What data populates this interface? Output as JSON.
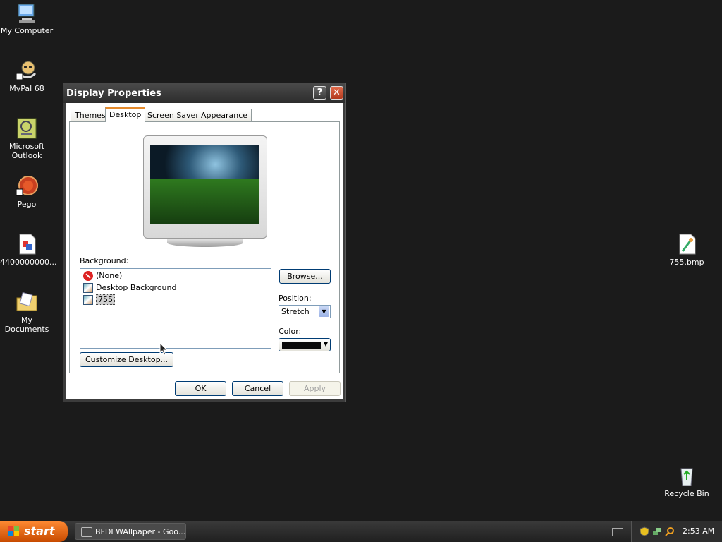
{
  "desktop": {
    "icons": [
      {
        "label": "My Computer"
      },
      {
        "label": "MyPal 68"
      },
      {
        "label": "Microsoft Outlook"
      },
      {
        "label": "Pego"
      },
      {
        "label": "4400000000..."
      },
      {
        "label": "My Documents"
      },
      {
        "label": "755.bmp"
      },
      {
        "label": "Recycle Bin"
      }
    ]
  },
  "dialog": {
    "title": "Display Properties",
    "help_glyph": "?",
    "close_glyph": "✕",
    "tabs": [
      {
        "label": "Themes"
      },
      {
        "label": "Desktop"
      },
      {
        "label": "Screen Saver"
      },
      {
        "label": "Appearance"
      }
    ],
    "active_tab": "Desktop",
    "background_label": "Background:",
    "background_items": [
      {
        "label": "(None)"
      },
      {
        "label": "Desktop Background"
      },
      {
        "label": "755"
      }
    ],
    "selected_background": "755",
    "browse_label": "Browse...",
    "position_label": "Position:",
    "position_value": "Stretch",
    "color_label": "Color:",
    "color_value": "#0a0a0a",
    "customize_label": "Customize Desktop...",
    "ok_label": "OK",
    "cancel_label": "Cancel",
    "apply_label": "Apply"
  },
  "taskbar": {
    "start_label": "start",
    "task_button_label": "BFDI WAllpaper - Goo...",
    "clock": "2:53 AM"
  },
  "colors": {
    "desktop_bg": "#1b1b1b",
    "start_orange": "#e9691a",
    "tab_highlight": "#e68b2c"
  }
}
